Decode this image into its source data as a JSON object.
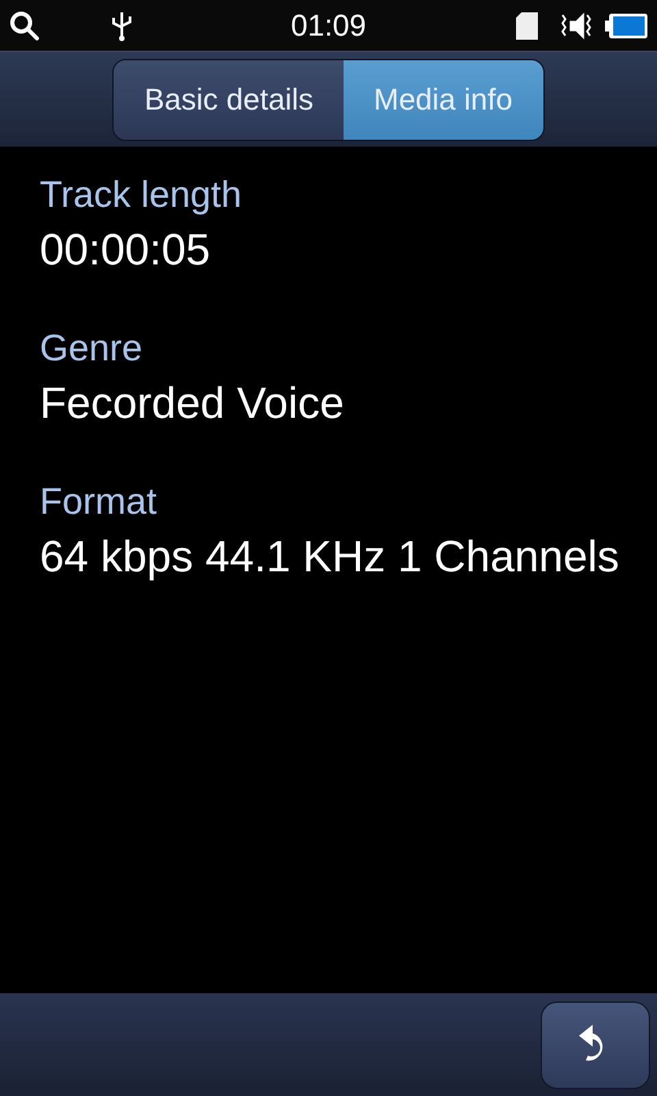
{
  "status_bar": {
    "time": "01:09"
  },
  "tabs": [
    {
      "label": "Basic details",
      "selected": false
    },
    {
      "label": "Media info",
      "selected": true
    }
  ],
  "fields": [
    {
      "label": "Track length",
      "value": "00:00:05"
    },
    {
      "label": "Genre",
      "value": "Fecorded Voice"
    },
    {
      "label": "Format",
      "value": "64 kbps 44.1 KHz 1 Channels"
    }
  ]
}
